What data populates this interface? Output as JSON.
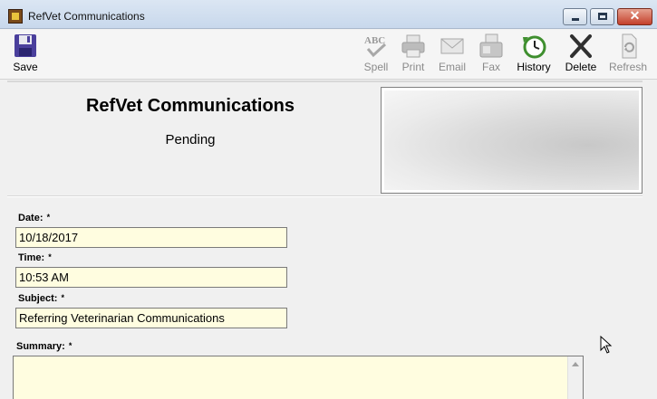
{
  "window": {
    "title": "RefVet Communications"
  },
  "toolbar": {
    "save_label": "Save",
    "spell_label": "Spell",
    "print_label": "Print",
    "email_label": "Email",
    "fax_label": "Fax",
    "history_label": "History",
    "delete_label": "Delete",
    "refresh_label": "Refresh"
  },
  "header": {
    "title": "RefVet Communications",
    "status": "Pending"
  },
  "form": {
    "date": {
      "label": "Date:",
      "required": "*",
      "value": "10/18/2017"
    },
    "time": {
      "label": "Time:",
      "required": "*",
      "value": "10:53 AM"
    },
    "subject": {
      "label": "Subject:",
      "required": "*",
      "value": "Referring Veterinarian Communications"
    },
    "summary": {
      "label": "Summary:",
      "required": "*",
      "value": ""
    }
  },
  "colors": {
    "input_background": "#fffde0",
    "titlebar": "#c8d8ec",
    "close_button": "#c4402b"
  }
}
